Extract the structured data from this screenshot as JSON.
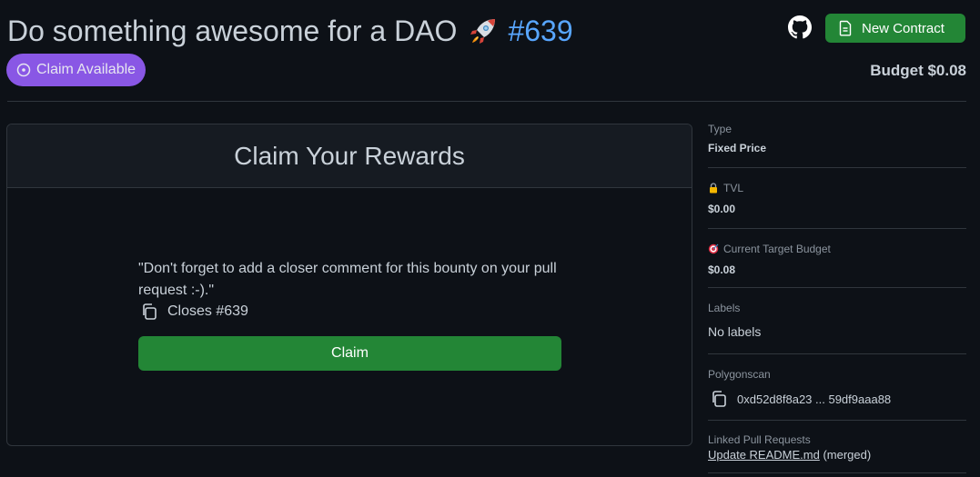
{
  "header": {
    "title": "Do something awesome for a DAO",
    "rocket_icon": "rocket-emoji",
    "issue_number": "#639",
    "status_badge": "Claim Available",
    "new_contract_label": "New Contract",
    "budget_label": "Budget $0.08"
  },
  "card": {
    "heading": "Claim Your Rewards",
    "quote": "\"Don't forget to add a closer comment for this bounty on your pull request :-).\"",
    "closes_text": "Closes #639",
    "claim_button": "Claim"
  },
  "sidebar": {
    "type_label": "Type",
    "type_value": "Fixed Price",
    "tvl_label": "TVL",
    "tvl_value": "$0.00",
    "target_label": "Current Target Budget",
    "target_value": "$0.08",
    "labels_label": "Labels",
    "labels_value": "No labels",
    "polygonscan_label": "Polygonscan",
    "polygonscan_value": "0xd52d8f8a23 ... 59df9aaa88",
    "linked_label": "Linked Pull Requests",
    "linked_pr_title": "Update README.md",
    "linked_pr_status": "(merged)"
  },
  "colors": {
    "background": "#0d1117",
    "accent_green": "#238636",
    "badge_purple": "#8957e5",
    "link_blue": "#58a6ff",
    "border": "#30363d"
  }
}
